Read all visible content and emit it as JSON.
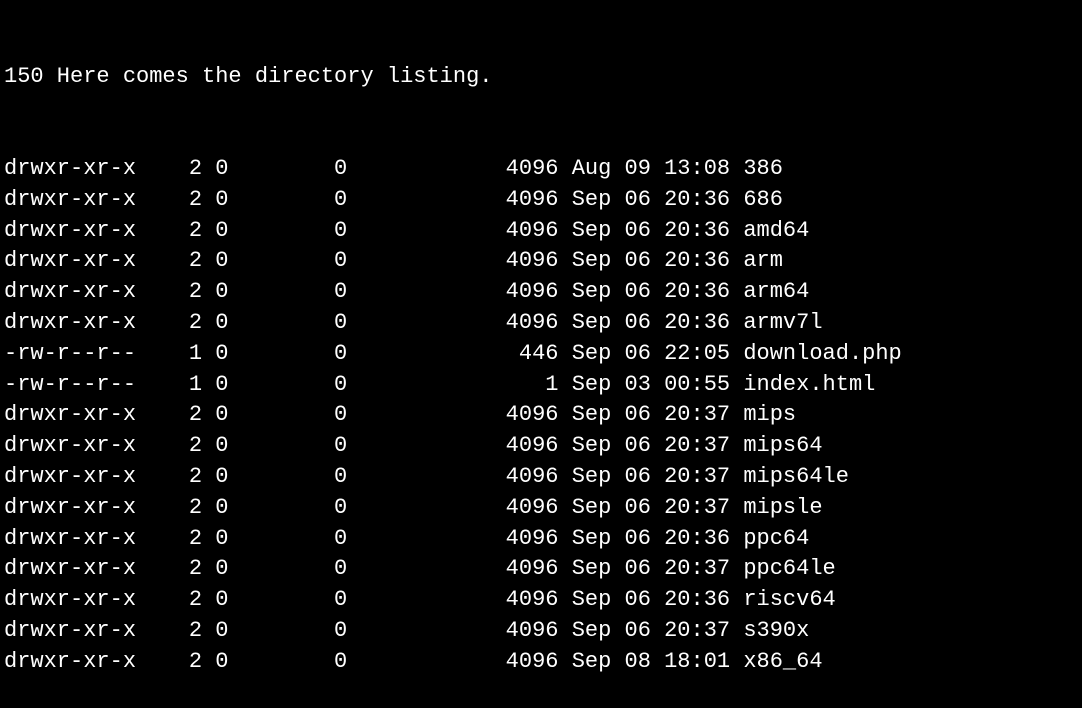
{
  "header_line": "150 Here comes the directory listing.",
  "listing": [
    {
      "perms": "drwxr-xr-x",
      "links": "2",
      "owner": "0",
      "group": "0",
      "size": "4096",
      "date": "Aug 09 13:08",
      "name": "386"
    },
    {
      "perms": "drwxr-xr-x",
      "links": "2",
      "owner": "0",
      "group": "0",
      "size": "4096",
      "date": "Sep 06 20:36",
      "name": "686"
    },
    {
      "perms": "drwxr-xr-x",
      "links": "2",
      "owner": "0",
      "group": "0",
      "size": "4096",
      "date": "Sep 06 20:36",
      "name": "amd64"
    },
    {
      "perms": "drwxr-xr-x",
      "links": "2",
      "owner": "0",
      "group": "0",
      "size": "4096",
      "date": "Sep 06 20:36",
      "name": "arm"
    },
    {
      "perms": "drwxr-xr-x",
      "links": "2",
      "owner": "0",
      "group": "0",
      "size": "4096",
      "date": "Sep 06 20:36",
      "name": "arm64"
    },
    {
      "perms": "drwxr-xr-x",
      "links": "2",
      "owner": "0",
      "group": "0",
      "size": "4096",
      "date": "Sep 06 20:36",
      "name": "armv7l"
    },
    {
      "perms": "-rw-r--r--",
      "links": "1",
      "owner": "0",
      "group": "0",
      "size": "446",
      "date": "Sep 06 22:05",
      "name": "download.php"
    },
    {
      "perms": "-rw-r--r--",
      "links": "1",
      "owner": "0",
      "group": "0",
      "size": "1",
      "date": "Sep 03 00:55",
      "name": "index.html"
    },
    {
      "perms": "drwxr-xr-x",
      "links": "2",
      "owner": "0",
      "group": "0",
      "size": "4096",
      "date": "Sep 06 20:37",
      "name": "mips"
    },
    {
      "perms": "drwxr-xr-x",
      "links": "2",
      "owner": "0",
      "group": "0",
      "size": "4096",
      "date": "Sep 06 20:37",
      "name": "mips64"
    },
    {
      "perms": "drwxr-xr-x",
      "links": "2",
      "owner": "0",
      "group": "0",
      "size": "4096",
      "date": "Sep 06 20:37",
      "name": "mips64le"
    },
    {
      "perms": "drwxr-xr-x",
      "links": "2",
      "owner": "0",
      "group": "0",
      "size": "4096",
      "date": "Sep 06 20:37",
      "name": "mipsle"
    },
    {
      "perms": "drwxr-xr-x",
      "links": "2",
      "owner": "0",
      "group": "0",
      "size": "4096",
      "date": "Sep 06 20:36",
      "name": "ppc64"
    },
    {
      "perms": "drwxr-xr-x",
      "links": "2",
      "owner": "0",
      "group": "0",
      "size": "4096",
      "date": "Sep 06 20:37",
      "name": "ppc64le"
    },
    {
      "perms": "drwxr-xr-x",
      "links": "2",
      "owner": "0",
      "group": "0",
      "size": "4096",
      "date": "Sep 06 20:36",
      "name": "riscv64"
    },
    {
      "perms": "drwxr-xr-x",
      "links": "2",
      "owner": "0",
      "group": "0",
      "size": "4096",
      "date": "Sep 06 20:37",
      "name": "s390x"
    },
    {
      "perms": "drwxr-xr-x",
      "links": "2",
      "owner": "0",
      "group": "0",
      "size": "4096",
      "date": "Sep 08 18:01",
      "name": "x86_64"
    }
  ]
}
